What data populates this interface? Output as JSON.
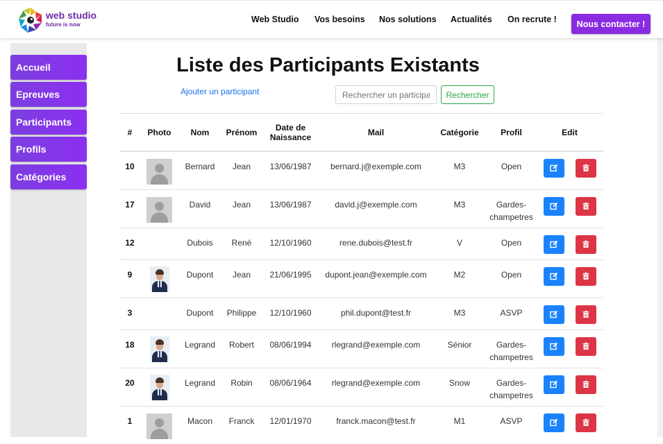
{
  "header": {
    "logo": {
      "name": "web studio",
      "tagline": "future is now"
    },
    "nav": [
      "Web Studio",
      "Vos besoins",
      "Nos solutions",
      "Actualités",
      "On recrute !"
    ],
    "contact_label": "Nous contacter !",
    "accent_color": "#8a2be2"
  },
  "sidebar": {
    "items": [
      {
        "label": "Accueil"
      },
      {
        "label": "Epreuves"
      },
      {
        "label": "Participants"
      },
      {
        "label": "Profils"
      },
      {
        "label": "Catégories"
      }
    ]
  },
  "main": {
    "title": "Liste des Participants Existants",
    "add_link": "Ajouter un participant",
    "search": {
      "placeholder": "Rechercher un participant",
      "value": "",
      "button": "Rechercher"
    },
    "table": {
      "headers": [
        "#",
        "Photo",
        "Nom",
        "Prénom",
        "Date de Naissance",
        "Mail",
        "Catégorie",
        "Profil",
        "Edit"
      ],
      "rows": [
        {
          "id": "10",
          "photo": "placeholder",
          "nom": "Bernard",
          "prenom": "Jean",
          "naissance": "13/06/1987",
          "mail": "bernard.j@exemple.com",
          "categorie": "M3",
          "profil": "Open"
        },
        {
          "id": "17",
          "photo": "placeholder",
          "nom": "David",
          "prenom": "Jean",
          "naissance": "13/06/1987",
          "mail": "david.j@exemple.com",
          "categorie": "M3",
          "profil": "Gardes-champetres"
        },
        {
          "id": "12",
          "photo": "none",
          "nom": "Dubois",
          "prenom": "René",
          "naissance": "12/10/1960",
          "mail": "rene.dubois@test.fr",
          "categorie": "V",
          "profil": "Open"
        },
        {
          "id": "9",
          "photo": "portrait",
          "nom": "Dupont",
          "prenom": "Jean",
          "naissance": "21/06/1995",
          "mail": "dupont.jean@exemple.com",
          "categorie": "M2",
          "profil": "Open"
        },
        {
          "id": "3",
          "photo": "none",
          "nom": "Dupont",
          "prenom": "Philippe",
          "naissance": "12/10/1960",
          "mail": "phil.dupont@test.fr",
          "categorie": "M3",
          "profil": "ASVP"
        },
        {
          "id": "18",
          "photo": "portrait",
          "nom": "Legrand",
          "prenom": "Robert",
          "naissance": "08/06/1994",
          "mail": "rlegrand@exemple.com",
          "categorie": "Sénior",
          "profil": "Gardes-champetres"
        },
        {
          "id": "20",
          "photo": "portrait",
          "nom": "Legrand",
          "prenom": "Robin",
          "naissance": "08/06/1964",
          "mail": "rlegrand@exemple.com",
          "categorie": "Snow",
          "profil": "Gardes-champetres"
        },
        {
          "id": "1",
          "photo": "placeholder",
          "nom": "Macon",
          "prenom": "Franck",
          "naissance": "12/01/1970",
          "mail": "franck.macon@test.fr",
          "categorie": "M1",
          "profil": "ASVP"
        }
      ],
      "actions": [
        {
          "name": "edit",
          "icon": "edit-icon",
          "color": "#1a82fb"
        },
        {
          "name": "delete",
          "icon": "trash-icon",
          "color": "#dc3545"
        }
      ]
    }
  }
}
